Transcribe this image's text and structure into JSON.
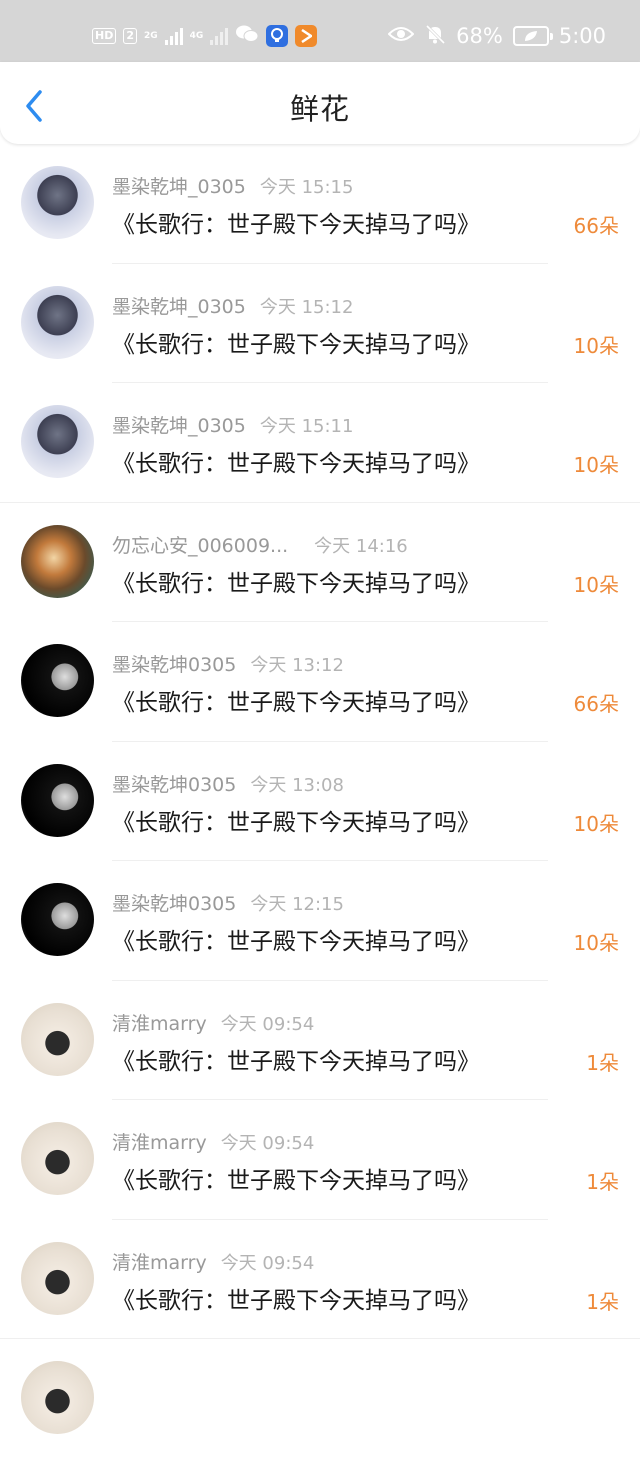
{
  "status_bar": {
    "hd": "HD",
    "sim": "2",
    "net1": "2G",
    "net2": "4G",
    "wechat_icon": "wechat-icon",
    "app1_icon": "bulb-icon",
    "app2_icon": "play-icon",
    "eye_icon": "eye-icon",
    "mute_icon": "bell-off-icon",
    "battery_percent": "68%",
    "time": "5:00",
    "color": "#d6d6d6"
  },
  "header": {
    "title": "鲜花",
    "back_icon": "chevron-left-icon",
    "accent": "#2d8cf0"
  },
  "items": [
    {
      "user": "墨染乾坤_0305",
      "time": "今天 15:15",
      "book": "《长歌行：世子殿下今天掉马了吗》",
      "flowers": "66朵",
      "avatar": "avatar-man-suit"
    },
    {
      "user": "墨染乾坤_0305",
      "time": "今天 15:12",
      "book": "《长歌行：世子殿下今天掉马了吗》",
      "flowers": "10朵",
      "avatar": "avatar-man-suit"
    },
    {
      "user": "墨染乾坤_0305",
      "time": "今天 15:11",
      "book": "《长歌行：世子殿下今天掉马了吗》",
      "flowers": "10朵",
      "avatar": "avatar-man-suit"
    },
    {
      "user": "勿忘心安_006009...",
      "time": "今天 14:16",
      "book": "《长歌行：世子殿下今天掉马了吗》",
      "flowers": "10朵",
      "avatar": "avatar-girl-painting"
    },
    {
      "user": "墨染乾坤0305",
      "time": "今天 13:12",
      "book": "《长歌行：世子殿下今天掉马了吗》",
      "flowers": "66朵",
      "avatar": "avatar-man-masked"
    },
    {
      "user": "墨染乾坤0305",
      "time": "今天 13:08",
      "book": "《长歌行：世子殿下今天掉马了吗》",
      "flowers": "10朵",
      "avatar": "avatar-man-masked"
    },
    {
      "user": "墨染乾坤0305",
      "time": "今天 12:15",
      "book": "《长歌行：世子殿下今天掉马了吗》",
      "flowers": "10朵",
      "avatar": "avatar-man-masked"
    },
    {
      "user": "清淮marry",
      "time": "今天 09:54",
      "book": "《长歌行：世子殿下今天掉马了吗》",
      "flowers": "1朵",
      "avatar": "avatar-girl-back"
    },
    {
      "user": "清淮marry",
      "time": "今天 09:54",
      "book": "《长歌行：世子殿下今天掉马了吗》",
      "flowers": "1朵",
      "avatar": "avatar-girl-back"
    },
    {
      "user": "清淮marry",
      "time": "今天 09:54",
      "book": "《长歌行：世子殿下今天掉马了吗》",
      "flowers": "1朵",
      "avatar": "avatar-girl-back"
    }
  ],
  "colors": {
    "flower_count": "#ee8a3a",
    "username": "#999999",
    "book_title": "#1a1a1a"
  }
}
